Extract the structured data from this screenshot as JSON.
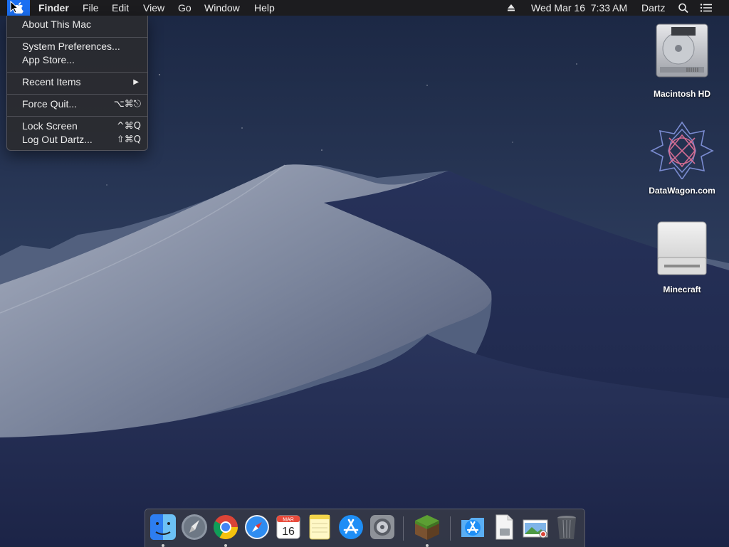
{
  "menubar": {
    "apple_icon": "apple-logo-icon",
    "app_name": "Finder",
    "menus": [
      "File",
      "Edit",
      "View",
      "Go",
      "Window",
      "Help"
    ],
    "status": {
      "eject_icon": "eject-icon",
      "datetime": "Wed Mar 16  7:33 AM",
      "user": "Dartz",
      "search_icon": "spotlight-search-icon",
      "notification_icon": "notification-center-icon"
    }
  },
  "apple_menu": {
    "about": "About This Mac",
    "system_preferences": "System Preferences...",
    "app_store": "App Store...",
    "recent_items": "Recent Items",
    "force_quit": "Force Quit...",
    "force_quit_shortcut": "⌥⌘⎋",
    "lock_screen": "Lock Screen",
    "lock_screen_shortcut": "^⌘Q",
    "log_out": "Log Out Dartz...",
    "log_out_shortcut": "⇧⌘Q"
  },
  "desktop_icons": [
    {
      "label": "Macintosh HD",
      "icon": "hard-drive-icon"
    },
    {
      "label": "DataWagon.com",
      "icon": "datawagon-logo-icon"
    },
    {
      "label": "Minecraft",
      "icon": "external-drive-icon"
    }
  ],
  "dock": {
    "apps": [
      {
        "name": "Finder",
        "icon": "finder-icon",
        "running": true
      },
      {
        "name": "Launchpad",
        "icon": "launchpad-icon",
        "running": false
      },
      {
        "name": "Google Chrome",
        "icon": "chrome-icon",
        "running": true
      },
      {
        "name": "Safari",
        "icon": "safari-icon",
        "running": false
      },
      {
        "name": "Calendar",
        "icon": "calendar-icon",
        "running": false,
        "month": "MAR",
        "day": "16"
      },
      {
        "name": "Notes",
        "icon": "notes-icon",
        "running": false
      },
      {
        "name": "App Store",
        "icon": "app-store-icon",
        "running": false
      },
      {
        "name": "System Preferences",
        "icon": "system-preferences-icon",
        "running": false
      },
      {
        "name": "Minecraft",
        "icon": "minecraft-icon",
        "running": true
      },
      {
        "name": "Applications",
        "icon": "applications-folder-icon",
        "running": false
      },
      {
        "name": "Document",
        "icon": "document-icon",
        "running": false
      },
      {
        "name": "Preview",
        "icon": "preview-icon",
        "running": false
      },
      {
        "name": "Trash",
        "icon": "trash-icon",
        "running": false
      }
    ]
  },
  "colors": {
    "menu_highlight": "#1b6ff2",
    "menubar_bg": "#1c1c1e",
    "sky_top": "#1d2a45",
    "dune_light": "#8a93a8"
  }
}
